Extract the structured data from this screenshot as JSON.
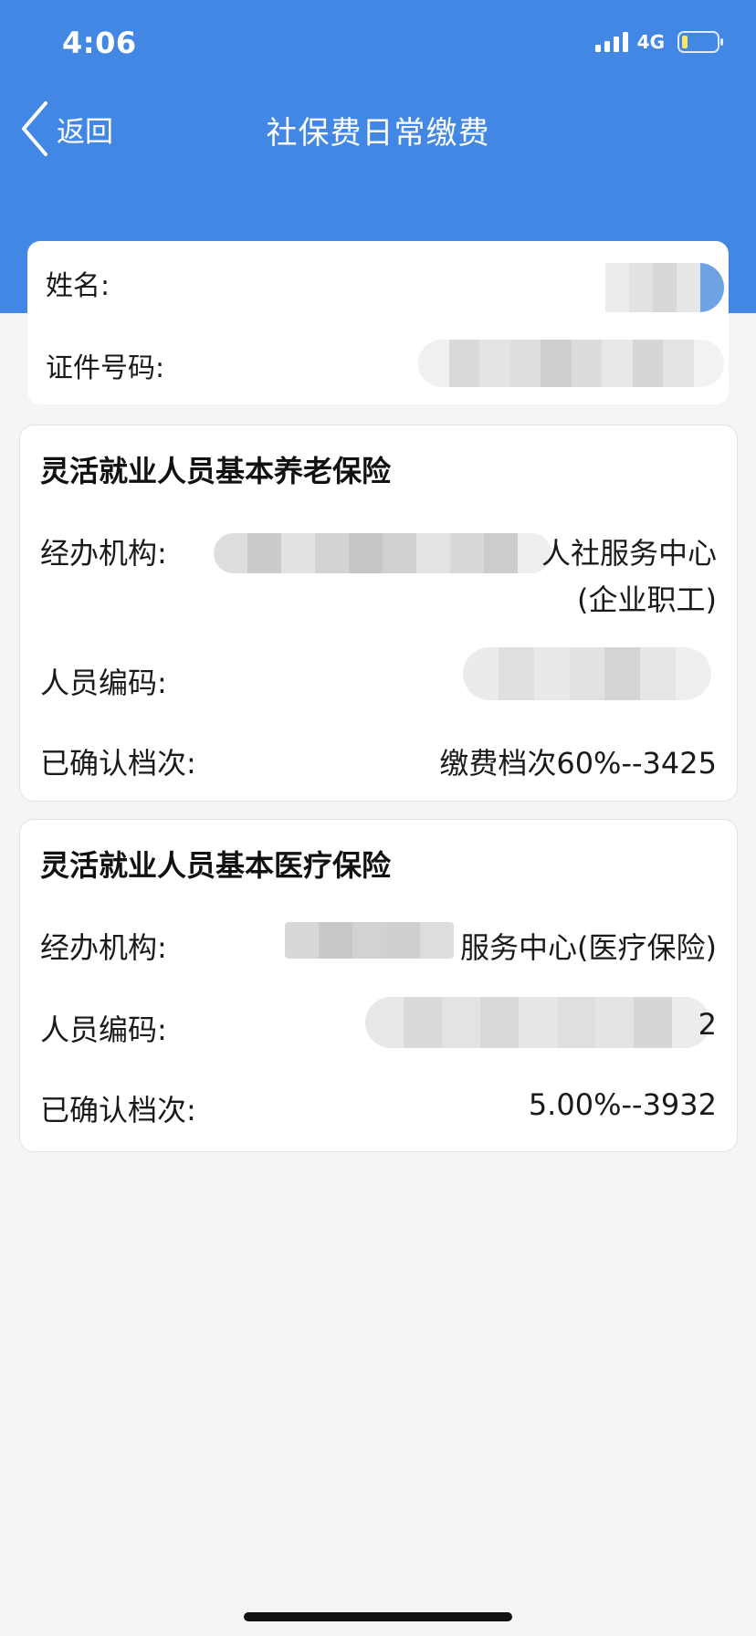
{
  "status_bar": {
    "time": "4:06",
    "network": "4G"
  },
  "nav": {
    "back_label": "返回",
    "title": "社保费日常缴费"
  },
  "identity": {
    "name_label": "姓名:",
    "id_label": "证件号码:"
  },
  "cards": [
    {
      "title": "灵活就业人员基本养老保险",
      "agency_label": "经办机构:",
      "agency_value_line1": "人社服务中心",
      "agency_value_line2": "(企业职工)",
      "person_code_label": "人员编码:",
      "grade_label": "已确认档次:",
      "grade_value": "缴费档次60%--3425"
    },
    {
      "title": "灵活就业人员基本医疗保险",
      "agency_label": "经办机构:",
      "agency_value": "服务中心(医疗保险)",
      "person_code_label": "人员编码:",
      "person_code_tail": "2",
      "grade_label": "已确认档次:",
      "grade_value": "5.00%--3932"
    }
  ],
  "colors": {
    "header_blue": "#4287e3",
    "background": "#f5f5f5",
    "card": "#ffffff"
  },
  "icons": {
    "back": "chevron-left-icon",
    "signal": "signal-bars-icon",
    "battery": "battery-icon"
  }
}
